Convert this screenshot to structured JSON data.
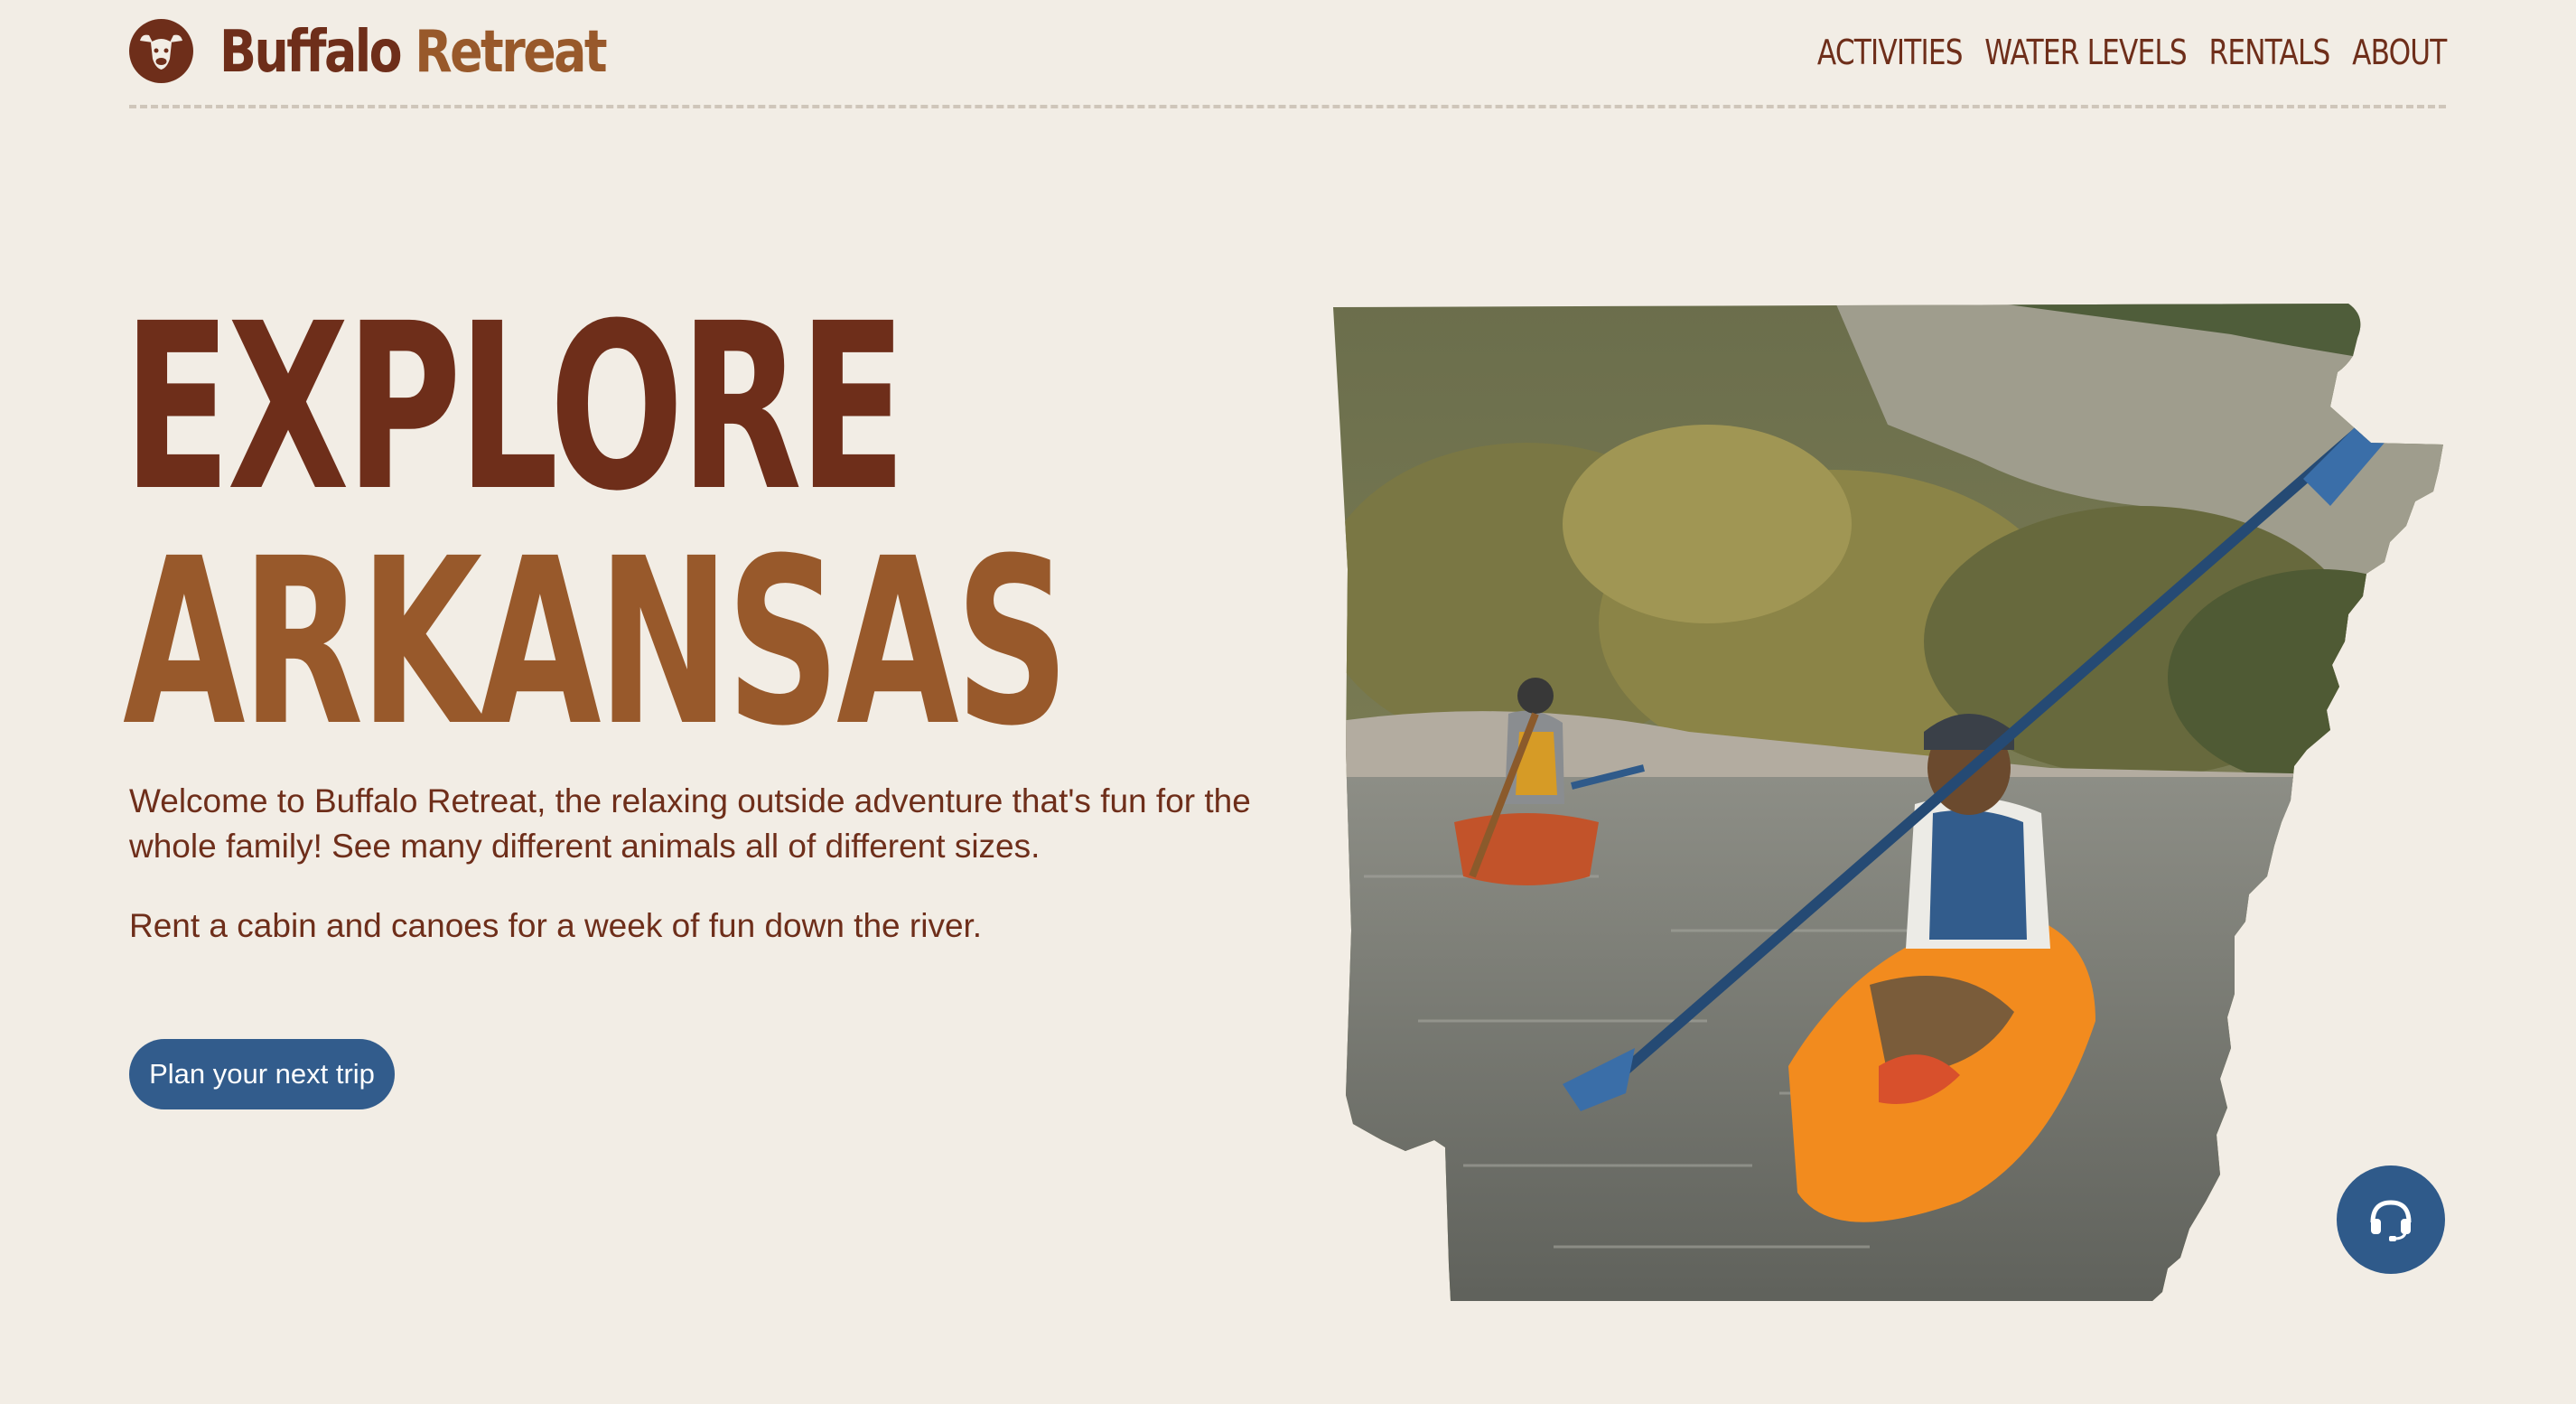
{
  "brand": {
    "name_part1": "Buffalo",
    "name_part2": "Retreat",
    "logo_icon": "buffalo-head-icon"
  },
  "nav": {
    "items": [
      {
        "label": "ACTIVITIES"
      },
      {
        "label": "WATER LEVELS"
      },
      {
        "label": "RENTALS"
      },
      {
        "label": "ABOUT"
      }
    ]
  },
  "hero": {
    "title_line1": "EXPLORE",
    "title_line2": "ARKANSAS",
    "intro": "Welcome to Buffalo Retreat, the relaxing outside adventure that's fun for the whole family! See many different animals all of different sizes.",
    "intro2": "Rent a cabin and canoes for a week of fun down the river.",
    "cta_label": "Plan your next trip",
    "image_subject": "kayakers on river in Arkansas state shape"
  },
  "support": {
    "icon": "headset-icon"
  },
  "colors": {
    "background": "#f2ede5",
    "brown_dark": "#6e2e1a",
    "brown_light": "#98592b",
    "blue": "#325c8c"
  }
}
